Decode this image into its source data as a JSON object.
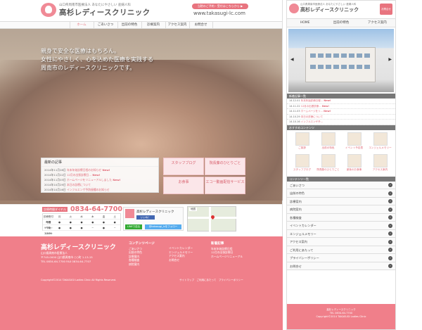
{
  "brand": {
    "sub": "山口県周南市医療法人 あなたにやさしい 産婦人科",
    "title": "高杉レディースクリニック",
    "header_badge": "当院のご予約・受付はこちらから ▶",
    "url": "www.takasugi-lc.com",
    "accent": "#e8747f",
    "footer_bg": "#f07f8a"
  },
  "nav": [
    "ホーム",
    "ごあいさつ",
    "出前の特色",
    "診療案内",
    "アクセス案内",
    "お問合せ"
  ],
  "hero": {
    "lines": [
      "親身で安全な医療はもちろん。",
      "女性にやさしく、心を込めた医療を実践する",
      "周南市のレディースクリニックです。"
    ]
  },
  "news": {
    "title": "最新の記事",
    "items": [
      {
        "date": "2014年11月28日",
        "text": "年末年始診療日程のお知らせ",
        "badge": "New!"
      },
      {
        "date": "2014年11月22日",
        "text": "12月の出張診療日…",
        "badge": "New!"
      },
      {
        "date": "2014年11月03日",
        "text": "ホームページをリニューアルしました",
        "badge": "New!"
      },
      {
        "date": "2014年10月29日",
        "text": "本日の診療について",
        "badge": ""
      },
      {
        "date": "2014年10月16日",
        "text": "インフルエンザ予防接種のお知らせ",
        "badge": ""
      }
    ]
  },
  "banners": {
    "staff": "スタッフブログ",
    "director": "院長藤のひとりごと",
    "eco": "エコー動画配信サービス",
    "food": "お食事"
  },
  "info": {
    "tel_label": "診療時間ダイヤル",
    "tel": "0834-64-7700",
    "sched_head": [
      "診療受付時間",
      "月",
      "火",
      "水",
      "木",
      "金",
      "土"
    ],
    "sched_rows": [
      [
        "午前 9:00〜12:30",
        "●",
        "●",
        "●",
        "●",
        "●",
        "●"
      ],
      [
        "午後 2:00〜6:00",
        "●",
        "●",
        "●",
        "−",
        "●",
        "−"
      ]
    ],
    "fb_name": "高杉レディースクリニック",
    "fb_like": "いいね！",
    "line": "LINEで送る",
    "twitter": "@takasugi_lcをフォロー",
    "map_label": "地図"
  },
  "footer": {
    "title": "高杉レディースクリニック",
    "addr": [
      "山口県周南市医療法人",
      "〒745-0000 山口県周南市 ○○町 1-13-15",
      "TEL 0834-64-7700 FAX 0834-64-7707"
    ],
    "contents_title": "コンテンツページ",
    "contents": [
      "ごあいさつ",
      "出前の特色",
      "診療案内",
      "各種検査",
      "病院案内"
    ],
    "contents2": [
      "イベントカレンダー",
      "エンジェルメモリー",
      "アクセス案内",
      "お問合せ"
    ],
    "news_title": "新着記事",
    "news": [
      "年末年始診療日程",
      "12月の出張診療日",
      "ホームページリニューアル"
    ],
    "copy": "Copyright©2014 TAKASUGI Ladies Clinic All Rights Reserved.",
    "links": "サイトマップ　ご利用にあたって　プライバシーポリシー"
  },
  "sp": {
    "tel_btn": "お問合せ",
    "nav": [
      "HOME",
      "出前の特色",
      "アクセス案内"
    ],
    "news_title": "新着記事一覧",
    "news": [
      {
        "date": "14.12.01",
        "text": "年末年始診療日程…",
        "badge": "New!"
      },
      {
        "date": "14.11.22",
        "text": "12月の出張診療…",
        "badge": "New!"
      },
      {
        "date": "14.11.03",
        "text": "ホームページをリ…",
        "badge": "New!"
      },
      {
        "date": "14.10.29",
        "text": "本日の診療について",
        "badge": ""
      },
      {
        "date": "14.10.16",
        "text": "インフルエンザ予…",
        "badge": ""
      }
    ],
    "recommend_title": "おすすめコンテンツ",
    "recommend": [
      "ご挨拶",
      "出前の特色",
      "イベント予定表",
      "エンジェルメモリー",
      "スタッフブログ",
      "院長藤のひとりごと",
      "産後のお食事",
      "アクセス案内"
    ],
    "contents_title": "コンテンツ一覧",
    "menu": [
      "ごあいさつ",
      "出前の特色",
      "診療案内",
      "病院案内",
      "各種検査",
      "イベントカレンダー",
      "エンジェルメモリー",
      "アクセス案内",
      "ご利用にあたって",
      "プライバシーポリシー",
      "お問合せ"
    ],
    "footer": [
      "高杉レディースクリニック",
      "TEL 0834-64-7700",
      "Copyright©2014 TAKASUGI Ladies Clinic"
    ]
  }
}
